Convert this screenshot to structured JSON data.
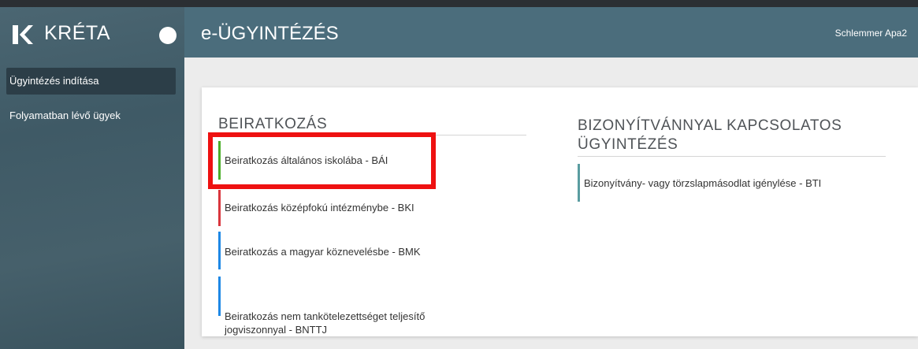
{
  "app": {
    "brand_name": "KRÉTA",
    "title": "e-ÜGYINTÉZÉS",
    "user_name": "Schlemmer Apa2"
  },
  "sidebar": {
    "items": [
      {
        "label": "Ügyintézés indítása",
        "active": true
      },
      {
        "label": "Folyamatban lévő ügyek",
        "active": false
      }
    ]
  },
  "sections": {
    "enrollment": {
      "title": "BEIRATKOZÁS",
      "items": [
        {
          "label": "Beiratkozás általános iskolába - BÁI",
          "accent": "#4caf2a"
        },
        {
          "label": "Beiratkozás középfokú intézménybe - BKI",
          "accent": "#d9363e"
        },
        {
          "label": "Beiratkozás a magyar köznevelésbe - BMK",
          "accent": "#1e88e5"
        },
        {
          "label": "Beiratkozás nem tankötelezettséget teljesítő\njogviszonnyal - BNTTJ",
          "accent": "#1e88e5"
        }
      ]
    },
    "certificates": {
      "title": "BIZONYÍTVÁNNYAL KAPCSOLATOS ÜGYINTÉZÉS",
      "items": [
        {
          "label": "Bizonyítvány- vagy törzslapmásodlat igénylése - BTI",
          "accent": "#5a9ca0"
        }
      ]
    }
  },
  "colors": {
    "header": "#4b6d7c",
    "sidebar": "#46606b",
    "highlight": "#ee1111"
  }
}
